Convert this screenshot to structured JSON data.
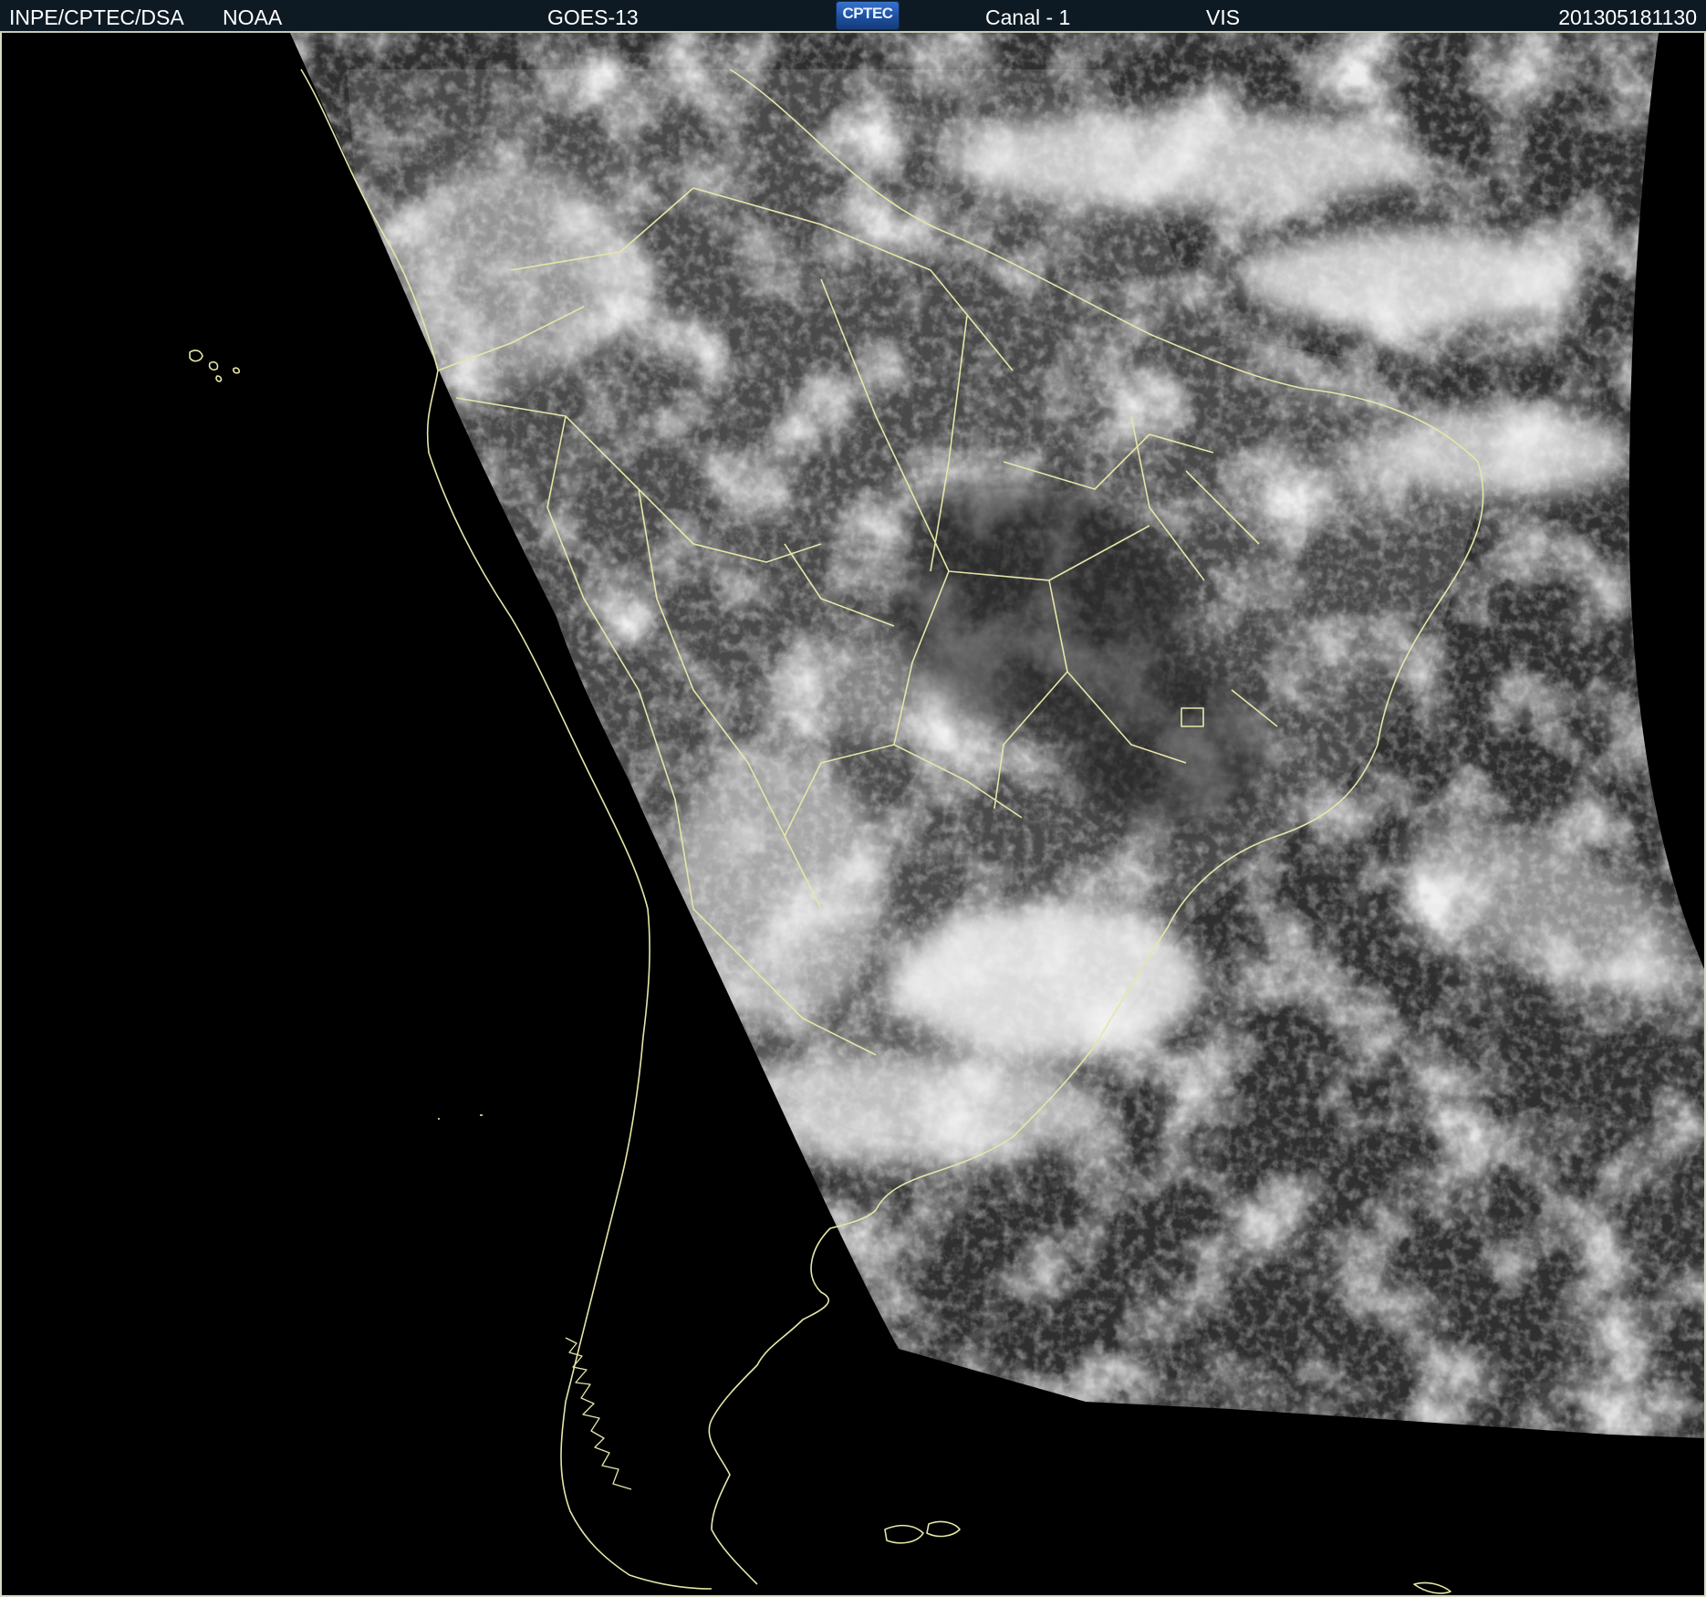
{
  "header": {
    "organization": "INPE/CPTEC/DSA",
    "agency": "NOAA",
    "satellite": "GOES-13",
    "logo_text": "CPTEC",
    "channel": "Canal - 1",
    "band": "VIS",
    "timestamp": "201305181130"
  },
  "colors": {
    "header_bg": "#0d1a24",
    "header_text": "#ffffff",
    "coastline": "#e6e6a8",
    "space": "#000000",
    "ocean": "#2f2f2f",
    "land": "#4a4a4a",
    "cloud": "#f2f2f2"
  }
}
